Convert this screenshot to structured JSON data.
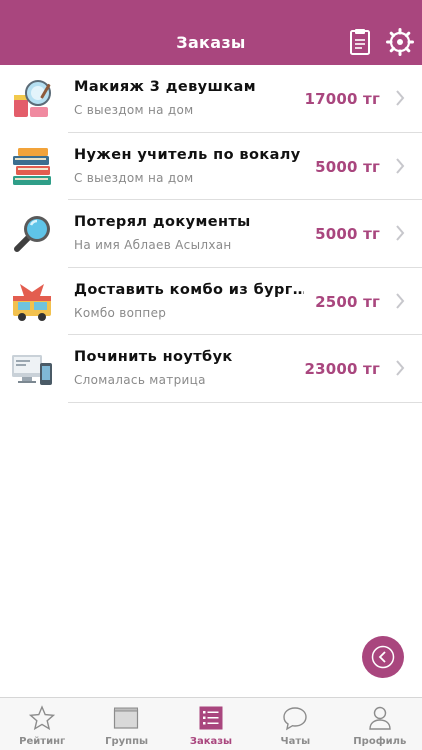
{
  "header": {
    "title": "Заказы",
    "brand_color": "#a9467e",
    "clipboard_icon": "clipboard-icon",
    "settings_icon": "gear-icon"
  },
  "orders": [
    {
      "title": "Макияж 3 девушкам",
      "subtitle": "С выездом на дом",
      "price": "17000 тг",
      "icon": "makeup-icon"
    },
    {
      "title": "Нужен учитель по вокалу",
      "subtitle": "С выездом на дом",
      "price": "5000 тг",
      "icon": "books-icon"
    },
    {
      "title": "Потерял документы",
      "subtitle": "На имя Аблаев Асылхан",
      "price": "5000 тг",
      "icon": "magnifier-icon"
    },
    {
      "title": "Доставить комбо из бург…",
      "subtitle": "Комбо воппер",
      "price": "2500 тг",
      "icon": "food-truck-icon"
    },
    {
      "title": "Починить ноутбук",
      "subtitle": "Сломалась матрица",
      "price": "23000 тг",
      "icon": "computer-icon"
    }
  ],
  "fab": {
    "icon": "back-arrow-icon"
  },
  "tabs": [
    {
      "label": "Рейтинг",
      "icon": "star-icon",
      "active": false
    },
    {
      "label": "Группы",
      "icon": "folder-icon",
      "active": false
    },
    {
      "label": "Заказы",
      "icon": "list-icon",
      "active": true
    },
    {
      "label": "Чаты",
      "icon": "chat-icon",
      "active": false
    },
    {
      "label": "Профиль",
      "icon": "person-icon",
      "active": false
    }
  ]
}
